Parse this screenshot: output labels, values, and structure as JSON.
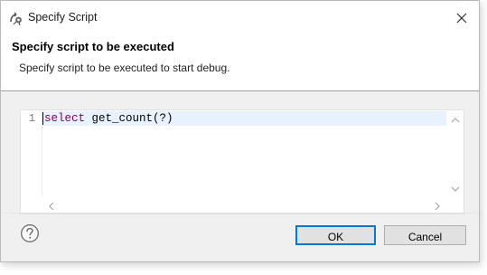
{
  "window": {
    "title": "Specify Script",
    "close_icon": "close-x"
  },
  "header": {
    "title": "Specify script to be executed",
    "description": "Specify script to be executed to start debug."
  },
  "editor": {
    "lines": [
      {
        "number": "1",
        "keyword": "select",
        "rest": " get_count(?)"
      }
    ],
    "keyword_color": "#7f0055",
    "current_line_color": "#e8f2fe"
  },
  "buttons": {
    "ok_label": "OK",
    "cancel_label": "Cancel",
    "help_icon": "help-question"
  },
  "colors": {
    "default_button_border": "#0078d7",
    "content_background": "#f0f0f0"
  }
}
